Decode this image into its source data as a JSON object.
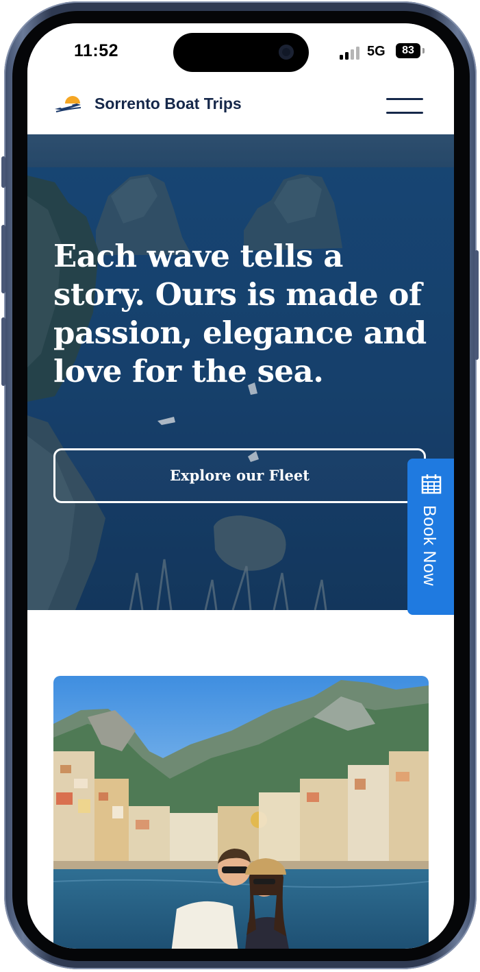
{
  "status_bar": {
    "time": "11:52",
    "network": "5G",
    "battery": "83"
  },
  "header": {
    "brand": "Sorrento Boat Trips"
  },
  "hero": {
    "title": "Each wave tells a story. Ours is made of passion, elegance and love for the sea.",
    "cta_label": "Explore our Fleet"
  },
  "book_now": {
    "label": "Book Now"
  },
  "colors": {
    "brand_navy": "#16284a",
    "book_blue": "#1f7ae0",
    "hero_sea": "#1c4572"
  }
}
